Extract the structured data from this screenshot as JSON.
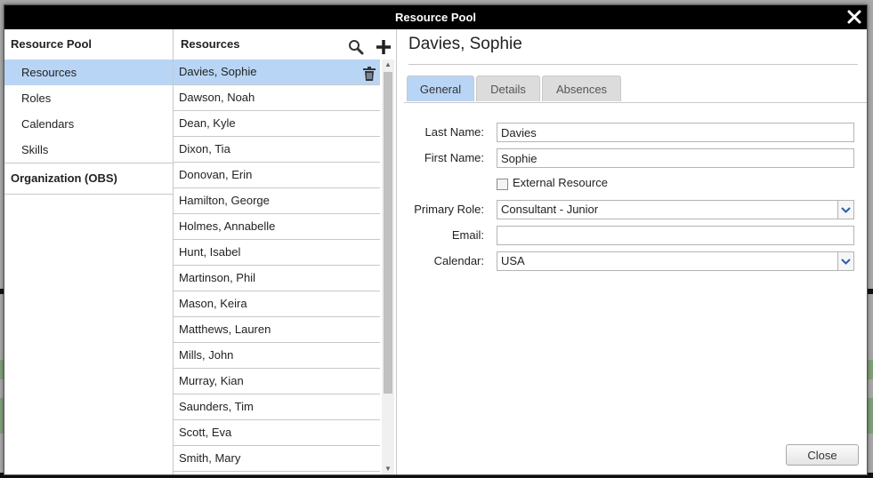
{
  "dialog": {
    "title": "Resource Pool"
  },
  "nav": {
    "header": "Resource Pool",
    "items": [
      {
        "label": "Resources"
      },
      {
        "label": "Roles"
      },
      {
        "label": "Calendars"
      },
      {
        "label": "Skills"
      }
    ],
    "section2": "Organization (OBS)"
  },
  "list": {
    "header": "Resources",
    "rows": [
      "Davies, Sophie",
      "Dawson, Noah",
      "Dean, Kyle",
      "Dixon, Tia",
      "Donovan, Erin",
      "Hamilton, George",
      "Holmes, Annabelle",
      "Hunt, Isabel",
      "Martinson, Phil",
      "Mason, Keira",
      "Matthews, Lauren",
      "Mills, John",
      "Murray, Kian",
      "Saunders, Tim",
      "Scott, Eva",
      "Smith, Mary"
    ]
  },
  "detail": {
    "title": "Davies, Sophie",
    "tabs": [
      {
        "label": "General"
      },
      {
        "label": "Details"
      },
      {
        "label": "Absences"
      }
    ],
    "last_name_label": "Last Name:",
    "last_name_value": "Davies",
    "first_name_label": "First Name:",
    "first_name_value": "Sophie",
    "external_label": "External Resource",
    "primary_role_label": "Primary Role:",
    "primary_role_value": "Consultant - Junior",
    "email_label": "Email:",
    "email_value": "",
    "calendar_label": "Calendar:",
    "calendar_value": "USA",
    "close_label": "Close"
  },
  "colors": {
    "selection": "#b8d5f5",
    "titlebar": "#000000"
  }
}
